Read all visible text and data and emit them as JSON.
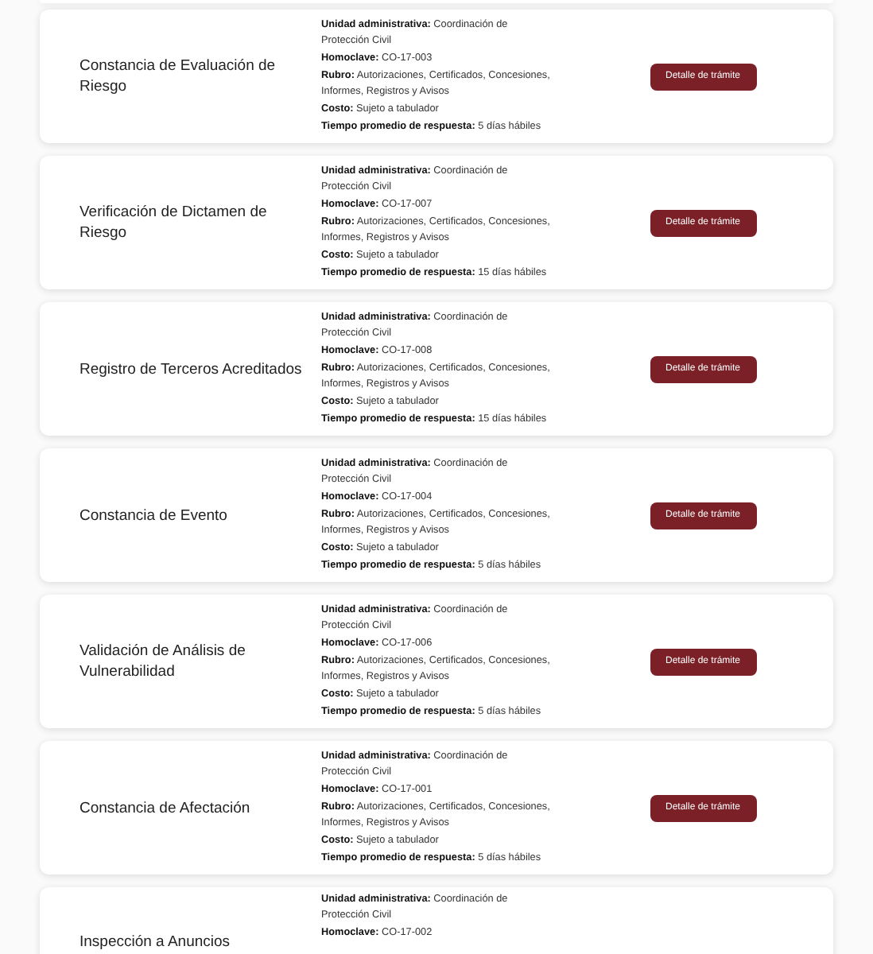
{
  "cards": [
    {
      "title": "Constancia de Evaluación de Riesgo",
      "details": [
        {
          "label": "Unidad administrativa:",
          "value": "Coordinación de Protección Civil"
        },
        {
          "label": "Homoclave:",
          "value": "CO-17-003"
        },
        {
          "label": "Rubro:",
          "value": "Autorizaciones, Certificados, Concesiones, Informes, Registros y Avisos"
        },
        {
          "label": "Costo:",
          "value": "Sujeto a tabulador"
        },
        {
          "label": "Tiempo promedio de respuesta:",
          "value": "5 días hábiles"
        }
      ],
      "button": "Detalle de trámite"
    },
    {
      "title": "Verificación de Dictamen de Riesgo",
      "details": [
        {
          "label": "Unidad administrativa:",
          "value": "Coordinación de Protección Civil"
        },
        {
          "label": "Homoclave:",
          "value": "CO-17-007"
        },
        {
          "label": "Rubro:",
          "value": "Autorizaciones, Certificados, Concesiones, Informes, Registros y Avisos"
        },
        {
          "label": "Costo:",
          "value": "Sujeto a tabulador"
        },
        {
          "label": "Tiempo promedio de respuesta:",
          "value": "15 días hábiles"
        }
      ],
      "button": "Detalle de trámite"
    },
    {
      "title": "Registro de Terceros Acreditados",
      "details": [
        {
          "label": "Unidad administrativa:",
          "value": "Coordinación de Protección Civil"
        },
        {
          "label": "Homoclave:",
          "value": "CO-17-008"
        },
        {
          "label": "Rubro:",
          "value": "Autorizaciones, Certificados, Concesiones, Informes, Registros y Avisos"
        },
        {
          "label": "Costo:",
          "value": "Sujeto a tabulador"
        },
        {
          "label": "Tiempo promedio de respuesta:",
          "value": "15 días hábiles"
        }
      ],
      "button": "Detalle de trámite"
    },
    {
      "title": "Constancia de Evento",
      "details": [
        {
          "label": "Unidad administrativa:",
          "value": "Coordinación de Protección Civil"
        },
        {
          "label": "Homoclave:",
          "value": "CO-17-004"
        },
        {
          "label": "Rubro:",
          "value": "Autorizaciones, Certificados, Concesiones, Informes, Registros y Avisos"
        },
        {
          "label": "Costo:",
          "value": "Sujeto a tabulador"
        },
        {
          "label": "Tiempo promedio de respuesta:",
          "value": "5 días hábiles"
        }
      ],
      "button": "Detalle de trámite"
    },
    {
      "title": "Validación de Análisis de Vulnerabilidad",
      "details": [
        {
          "label": "Unidad administrativa:",
          "value": "Coordinación de Protección Civil"
        },
        {
          "label": "Homoclave:",
          "value": "CO-17-006"
        },
        {
          "label": "Rubro:",
          "value": "Autorizaciones, Certificados, Concesiones, Informes, Registros y Avisos"
        },
        {
          "label": "Costo:",
          "value": "Sujeto a tabulador"
        },
        {
          "label": "Tiempo promedio de respuesta:",
          "value": "5 días hábiles"
        }
      ],
      "button": "Detalle de trámite"
    },
    {
      "title": "Constancia de Afectación",
      "details": [
        {
          "label": "Unidad administrativa:",
          "value": "Coordinación de Protección Civil"
        },
        {
          "label": "Homoclave:",
          "value": "CO-17-001"
        },
        {
          "label": "Rubro:",
          "value": "Autorizaciones, Certificados, Concesiones, Informes, Registros y Avisos"
        },
        {
          "label": "Costo:",
          "value": "Sujeto a tabulador"
        },
        {
          "label": "Tiempo promedio de respuesta:",
          "value": "5 días hábiles"
        }
      ],
      "button": "Detalle de trámite"
    },
    {
      "title": "Inspección a Anuncios",
      "details": [
        {
          "label": "Unidad administrativa:",
          "value": "Coordinación de Protección Civil"
        },
        {
          "label": "Homoclave:",
          "value": "CO-17-002"
        }
      ]
    }
  ]
}
